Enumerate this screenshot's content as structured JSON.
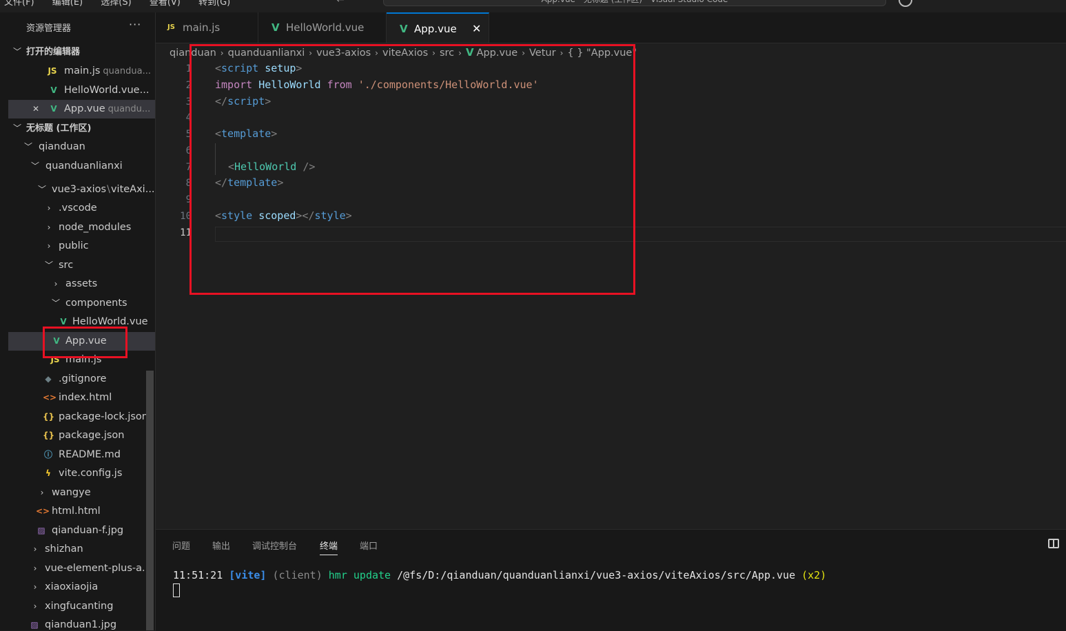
{
  "menu": [
    "文件(F)",
    "编辑(E)",
    "选择(S)",
    "查看(V)",
    "转到(G)"
  ],
  "command_center": "App.vue - 无标题 (工作区) - Visual Studio Code",
  "sidebar": {
    "title": "资源管理器",
    "more": "···",
    "open_editors_title": "打开的编辑器",
    "open_editors": [
      {
        "name": "main.js",
        "desc": "quandua..."
      },
      {
        "name": "HelloWorld.vue...",
        "desc": ""
      },
      {
        "name": "App.vue",
        "desc": "quandu..."
      }
    ],
    "workspace_title": "无标题 (工作区)",
    "tree": {
      "qianduan": "qianduan",
      "quanduanlianxi": "quanduanlianxi",
      "vue3_axios": "vue3-axios",
      "vue3_axios_sep": "\\",
      "vue3_axios_rest": "viteAxi...",
      "vscode": ".vscode",
      "node_modules": "node_modules",
      "public": "public",
      "src": "src",
      "assets": "assets",
      "components": "components",
      "helloworld": "HelloWorld.vue",
      "appvue": "App.vue",
      "mainjs": "main.js",
      "gitignore": ".gitignore",
      "indexhtml": "index.html",
      "packagelock": "package-lock.json",
      "packagejson": "package.json",
      "readme": "README.md",
      "viteconfig": "vite.config.js",
      "wangye": "wangye",
      "htmlhtml": "html.html",
      "qianduanf": "qianduan-f.jpg",
      "shizhan": "shizhan",
      "vueelement": "vue-element-plus-a...",
      "xiaoxiaojia": "xiaoxiaojia",
      "xingfucanting": "xingfucanting",
      "qianduan1": "qianduan1.jpg"
    }
  },
  "tabs": [
    {
      "label": "main.js",
      "icon": "JS"
    },
    {
      "label": "HelloWorld.vue",
      "icon": "V"
    },
    {
      "label": "App.vue",
      "icon": "V",
      "close": "✕"
    }
  ],
  "breadcrumb": [
    "qianduan",
    "quanduanlianxi",
    "vue3-axios",
    "viteAxios",
    "src",
    "App.vue",
    "Vetur",
    "{ } \"App.vue\""
  ],
  "editor": {
    "line_numbers": [
      "1",
      "2",
      "3",
      "4",
      "5",
      "6",
      "7",
      "8",
      "9",
      "10",
      "11"
    ],
    "code": {
      "l1_open": "<",
      "l1_tag": "script",
      "l1_attr": "setup",
      "l1_close": ">",
      "l2_kw": "import",
      "l2_id": "HelloWorld",
      "l2_from": "from",
      "l2_str": "'./components/HelloWorld.vue'",
      "l3_open": "</",
      "l3_tag": "script",
      "l3_close": ">",
      "l5_open": "<",
      "l5_tag": "template",
      "l5_close": ">",
      "l7_open": "<",
      "l7_tag": "HelloWorld",
      "l7_close": " />",
      "l8_open": "</",
      "l8_tag": "template",
      "l8_close": ">",
      "l10_open": "<",
      "l10_tag": "style",
      "l10_attr": "scoped",
      "l10_mid": "></",
      "l10_tag2": "style",
      "l10_close": ">"
    }
  },
  "panel": {
    "tabs": [
      "问题",
      "输出",
      "调试控制台",
      "终端",
      "端口"
    ],
    "active_tab": "终端",
    "terminal": {
      "time": "11:51:21",
      "vite": "[vite]",
      "client": "(client)",
      "hmr": "hmr update",
      "path": "/@fs/D:/qianduan/quanduanlianxi/vue3-axios/viteAxios/src/App.vue",
      "count": "(x2)"
    }
  },
  "colors": {
    "accent": "#0078d4",
    "highlight": "#e81123",
    "vue": "#41b883"
  }
}
